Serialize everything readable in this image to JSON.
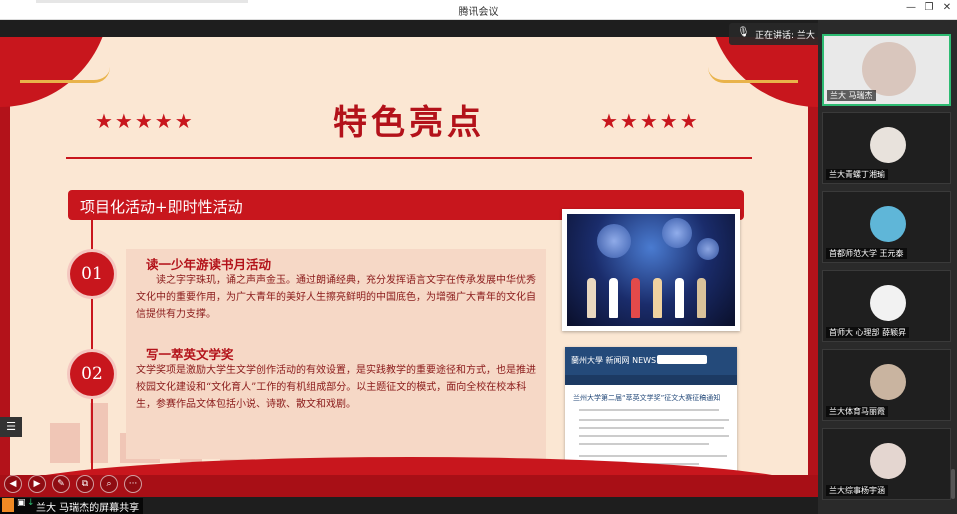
{
  "window": {
    "title": "腾讯会议"
  },
  "speaking": {
    "label": "正在讲话: 兰大 马瑞杰"
  },
  "share": {
    "label": "兰大 马瑞杰的屏幕共享"
  },
  "slide": {
    "title": "特色亮点",
    "stars_left": "★★★★★",
    "stars_right": "★★★★★",
    "section_title": "项目化活动+即时性活动",
    "items": [
      {
        "num": "01",
        "heading": "读一少年游读书月活动",
        "body": "读之字字珠玑，诵之声声金玉。通过朗诵经典，充分发挥语言文字在传承发展中华优秀文化中的重要作用，为广大青年的美好人生擦亮鲜明的中国底色，为增强广大青年的文化自信提供有力支撑。"
      },
      {
        "num": "02",
        "heading": "写一萃英文学奖",
        "body": "文学奖项是激励大学生文学创作活动的有效设置，是实践教学的重要途径和方式，也是推进校园文化建设和“文化育人”工作的有机组成部分。以主题征文的模式，面向全校在校本科生，参赛作品文体包括小说、诗歌、散文和戏剧。"
      }
    ],
    "web_logo": "蘭州大學 新闻网 NEWS",
    "web_article": "兰州大学第二届“萃英文学奖”征文大赛征稿通知"
  },
  "participants": [
    {
      "name": "兰大 马瑞杰",
      "active": true,
      "avatar_color": "#d9c6bd"
    },
    {
      "name": "兰大青螺丁湘瑜",
      "active": false,
      "avatar_color": "#e8e2dc"
    },
    {
      "name": "首都师范大学 王元泰",
      "active": false,
      "avatar_color": "#5fb6d8"
    },
    {
      "name": "首师大 心理部 薛颖昇",
      "active": false,
      "avatar_color": "#f2f2f2"
    },
    {
      "name": "兰大体育马丽霞",
      "active": false,
      "avatar_color": "#c9b4a0"
    },
    {
      "name": "兰大综事杨宇涵",
      "active": false,
      "avatar_color": "#e4d6d0"
    }
  ],
  "controls": [
    "◀",
    "▶",
    "✎",
    "⧉",
    "⌕",
    "···"
  ],
  "colors": {
    "slide_red": "#c8161d",
    "slide_cream": "#fbe7d3",
    "active_border": "#2dbb72"
  }
}
